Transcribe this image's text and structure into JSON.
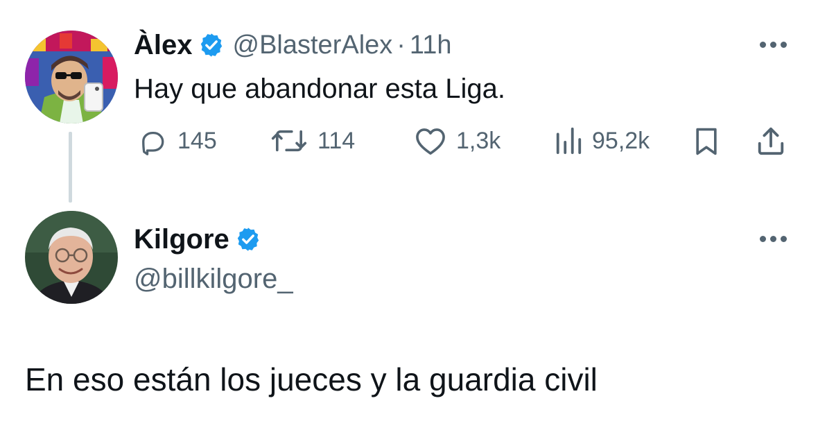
{
  "tweet": {
    "display_name": "Àlex",
    "handle": "@BlasterAlex",
    "separator": "·",
    "time": "11h",
    "text": "Hay que abandonar esta Liga.",
    "actions": {
      "replies": "145",
      "retweets": "114",
      "likes": "1,3k",
      "views": "95,2k"
    }
  },
  "reply": {
    "display_name": "Kilgore",
    "handle": "@billkilgore_",
    "text": "En eso están los jueces y la guardia civil"
  },
  "colors": {
    "text": "#0f1419",
    "secondary": "#536471",
    "verified": "#1d9bf0",
    "thread_line": "#cfd9de"
  },
  "icons": [
    "verified-badge-icon",
    "more-icon",
    "reply-icon",
    "retweet-icon",
    "like-icon",
    "views-icon",
    "bookmark-icon",
    "share-icon"
  ]
}
